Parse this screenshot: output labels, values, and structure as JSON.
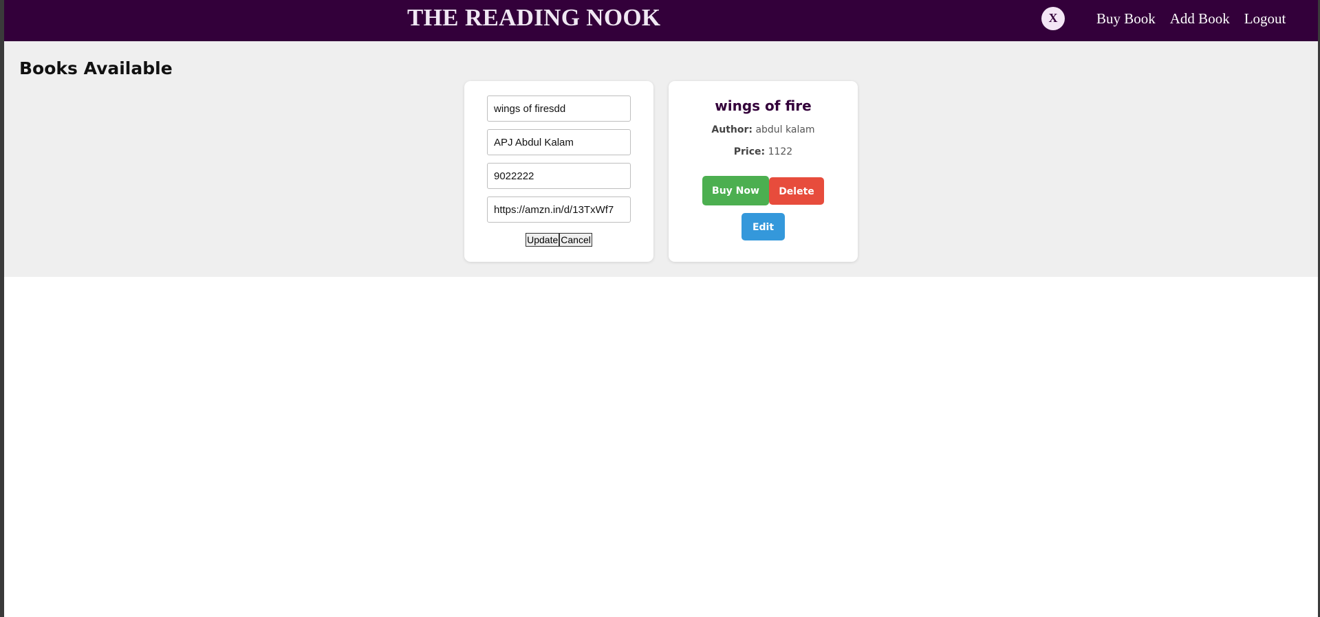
{
  "navbar": {
    "brand": "THE READING NOOK",
    "close_label": "X",
    "links": [
      "Buy Book",
      "Add Book",
      "Logout"
    ]
  },
  "main": {
    "title": "Books Available"
  },
  "edit_form": {
    "title_value": "wings of firesdd",
    "author_value": "APJ Abdul Kalam",
    "price_value": "9022222",
    "link_value": "https://amzn.in/d/13TxWf7",
    "update_label": "Update",
    "cancel_label": "Cancel"
  },
  "book": {
    "title": "wings of fire",
    "author_label": "Author:",
    "author": "abdul kalam",
    "price_label": "Price:",
    "price": "1122",
    "buy_label": "Buy Now",
    "delete_label": "Delete",
    "edit_label": "Edit"
  },
  "colors": {
    "navbar": "#33003a",
    "buy": "#4caf50",
    "delete": "#e74c3c",
    "edit": "#3498db"
  }
}
